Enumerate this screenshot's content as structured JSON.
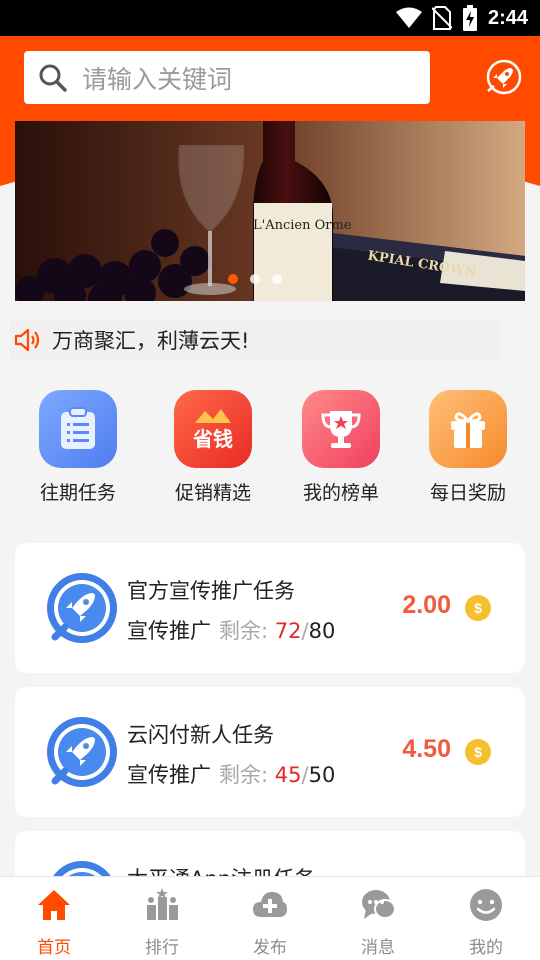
{
  "status_bar": {
    "time": "2:44",
    "icons": [
      "wifi-icon",
      "no-sim-icon",
      "battery-charging-icon"
    ]
  },
  "header": {
    "search_placeholder": "请输入关键词",
    "search_icon": "search-icon",
    "action_icon": "rocket-icon",
    "brand_color": "#ff4a00"
  },
  "banner": {
    "bottle_label": "L'Ancien Orme",
    "book_label": "KPIAL CROWN",
    "dot_count": 3,
    "active_dot": 0
  },
  "notice": {
    "icon": "speaker-icon",
    "text": "万商聚汇，利薄云天!"
  },
  "quick_menu": [
    {
      "label": "往期任务",
      "icon": "clipboard-icon",
      "color": "#4f86f7"
    },
    {
      "label": "促销精选",
      "icon": "save-money-icon",
      "icon_text": "省钱",
      "color": "#f0402e"
    },
    {
      "label": "我的榜单",
      "icon": "trophy-icon",
      "color": "#f2506a"
    },
    {
      "label": "每日奖励",
      "icon": "gift-icon",
      "color": "#f7993a"
    }
  ],
  "tasks": [
    {
      "title": "官方宣传推广任务",
      "category": "宣传推广",
      "remaining_label": "剩余:",
      "remaining": "72",
      "total": "80",
      "price": "2.00",
      "coin_symbol": "$"
    },
    {
      "title": "云闪付新人任务",
      "category": "宣传推广",
      "remaining_label": "剩余:",
      "remaining": "45",
      "total": "50",
      "price": "4.50",
      "coin_symbol": "$"
    },
    {
      "title": "太平通App注册任务"
    }
  ],
  "tabs": [
    {
      "label": "首页",
      "icon": "home-icon",
      "active": true
    },
    {
      "label": "排行",
      "icon": "ranking-icon",
      "active": false
    },
    {
      "label": "发布",
      "icon": "cloud-upload-icon",
      "active": false
    },
    {
      "label": "消息",
      "icon": "message-icon",
      "active": false
    },
    {
      "label": "我的",
      "icon": "profile-icon",
      "active": false
    }
  ]
}
